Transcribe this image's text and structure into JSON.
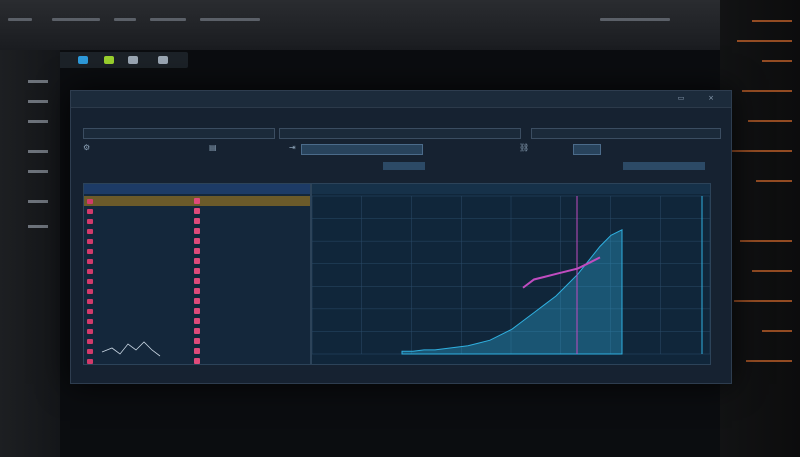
{
  "window": {
    "title": "",
    "min_icon": "minimize-icon",
    "close_icon": "close-icon"
  },
  "toolbar_rows": [
    {
      "left_label": "",
      "mid_label": "",
      "right_label": ""
    },
    {
      "left_label": "",
      "mid_label": "",
      "right_label": ""
    },
    {
      "left_label": "",
      "mid_label": "",
      "right_label": ""
    }
  ],
  "left_panel": {
    "header": "",
    "rows": [
      "",
      "",
      "",
      "",
      "",
      "",
      "",
      "",
      "",
      "",
      "",
      "",
      "",
      "",
      "",
      "",
      ""
    ]
  },
  "right_panel": {
    "header": "",
    "legend": [
      "",
      "",
      "",
      "",
      "",
      "",
      "",
      "",
      "",
      "",
      "",
      "",
      "",
      "",
      ""
    ],
    "axis": [
      "",
      "",
      "",
      "",
      "",
      "",
      "",
      ""
    ]
  },
  "status_bar": {
    "items": [
      "",
      "",
      "",
      "",
      "",
      "",
      ""
    ]
  },
  "colors": {
    "accent_blue": "#2f6fc8",
    "accent_pink": "#d23a6a",
    "accent_gold": "#b08a3a",
    "chart_cyan": "#2fb0e0",
    "chart_magenta": "#c04cc0",
    "grid": "#2b4b68"
  },
  "chart_data": {
    "type": "area",
    "x": [
      0,
      0.05,
      0.1,
      0.15,
      0.2,
      0.25,
      0.3,
      0.35,
      0.4,
      0.45,
      0.5,
      0.55,
      0.6,
      0.65,
      0.7,
      0.75,
      0.8,
      0.85,
      0.9,
      0.95,
      1.0
    ],
    "series": [
      {
        "values": [
          0.02,
          0.02,
          0.03,
          0.03,
          0.04,
          0.05,
          0.06,
          0.08,
          0.1,
          0.14,
          0.18,
          0.24,
          0.3,
          0.36,
          0.42,
          0.5,
          0.58,
          0.68,
          0.78,
          0.86,
          0.9
        ]
      },
      {
        "values": [
          0.0,
          0.0,
          0.0,
          0.0,
          0.0,
          0.0,
          0.0,
          0.0,
          0.0,
          0.0,
          0.0,
          0.48,
          0.54,
          0.56,
          0.58,
          0.6,
          0.62,
          0.66,
          0.7,
          0.0,
          0.0
        ]
      }
    ],
    "grid": true
  }
}
